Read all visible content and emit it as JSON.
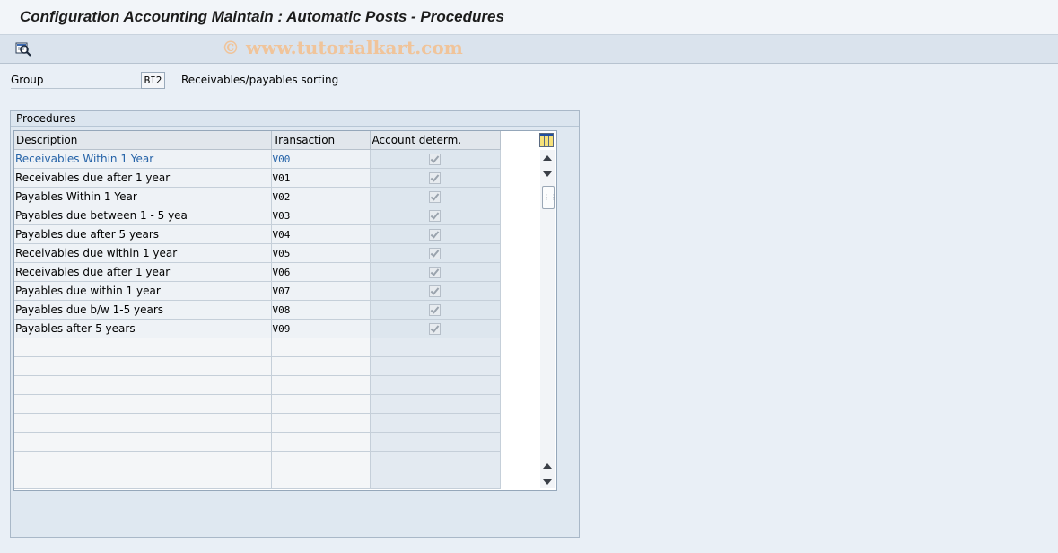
{
  "window": {
    "title": "Configuration Accounting Maintain : Automatic Posts - Procedures",
    "watermark": "© www.tutorialkart.com"
  },
  "toolbar": {
    "buttons": [
      {
        "icon": "display-details-icon"
      }
    ]
  },
  "group": {
    "label": "Group",
    "value": "BI2",
    "description": "Receivables/payables sorting"
  },
  "procedures": {
    "title": "Procedures",
    "columns": [
      "Description",
      "Transaction",
      "Account determ."
    ],
    "rows": [
      {
        "description": "Receivables Within 1 Year",
        "transaction": "V00",
        "account_determ": true
      },
      {
        "description": "Receivables due after 1 year",
        "transaction": "V01",
        "account_determ": true
      },
      {
        "description": "Payables Within 1 Year",
        "transaction": "V02",
        "account_determ": true
      },
      {
        "description": "Payables due between 1 - 5 yea",
        "transaction": "V03",
        "account_determ": true
      },
      {
        "description": "Payables due after 5 years",
        "transaction": "V04",
        "account_determ": true
      },
      {
        "description": "Receivables due within 1 year",
        "transaction": "V05",
        "account_determ": true
      },
      {
        "description": "Receivables due after 1 year",
        "transaction": "V06",
        "account_determ": true
      },
      {
        "description": "Payables due within 1 year",
        "transaction": "V07",
        "account_determ": true
      },
      {
        "description": "Payables due b/w 1-5 years",
        "transaction": "V08",
        "account_determ": true
      },
      {
        "description": "Payables after 5 years",
        "transaction": "V09",
        "account_determ": true
      }
    ],
    "selected_row": 0,
    "empty_rows": 8
  }
}
